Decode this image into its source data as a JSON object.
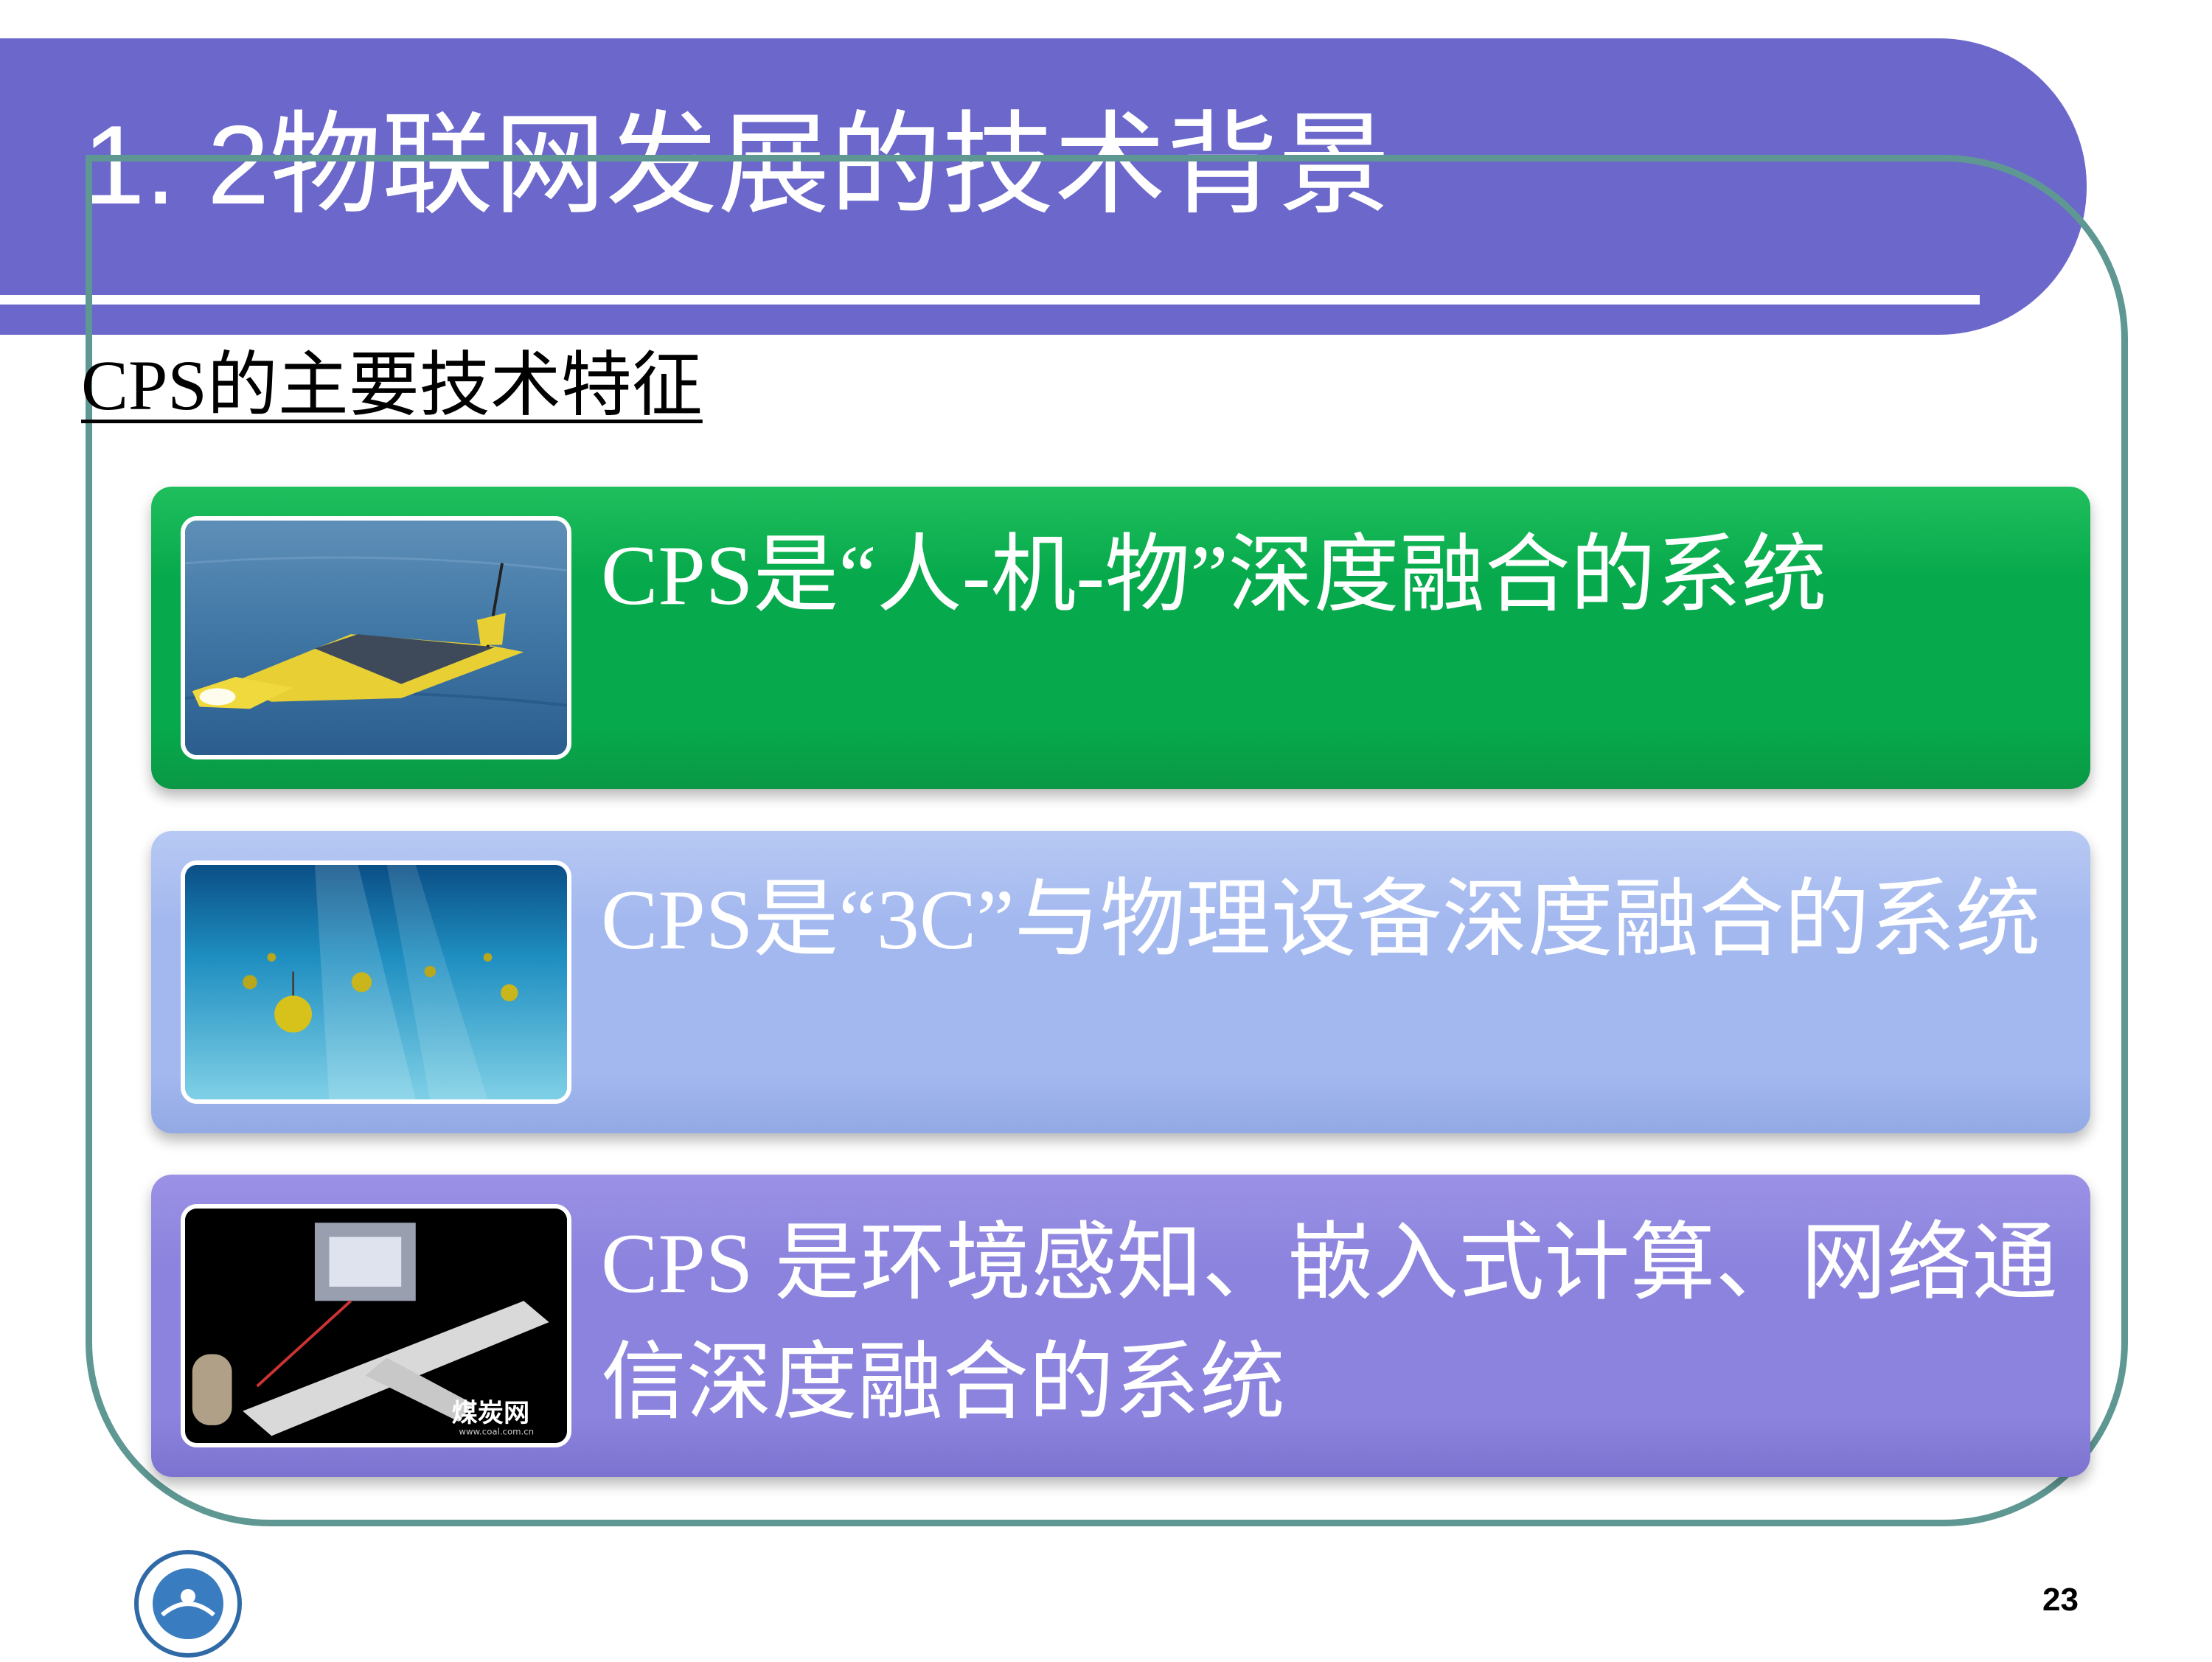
{
  "slide": {
    "title": "1. 2物联网发展的技术背景",
    "subtitle": "CPS的主要技术特征",
    "page_number": "23"
  },
  "cards": [
    {
      "text": "CPS是“人-机-物”深度融合的系统",
      "image": "solar-glider-on-water",
      "color": "#06a94b"
    },
    {
      "text": "CPS是“3C”与物理设备深度融合的系统",
      "image": "underwater-sensor-buoys",
      "color": "#a3b8ef"
    },
    {
      "text": "CPS 是环境感知、嵌入式计算、网络通信深度融合的系统",
      "image": "mine-tunnel-diagram",
      "color": "#8b83dd"
    }
  ],
  "thumb3_watermark": {
    "brand": "煤炭网",
    "url": "www.coal.com.cn"
  },
  "colors": {
    "banner": "#6b67cb",
    "frame": "#5f9893"
  }
}
